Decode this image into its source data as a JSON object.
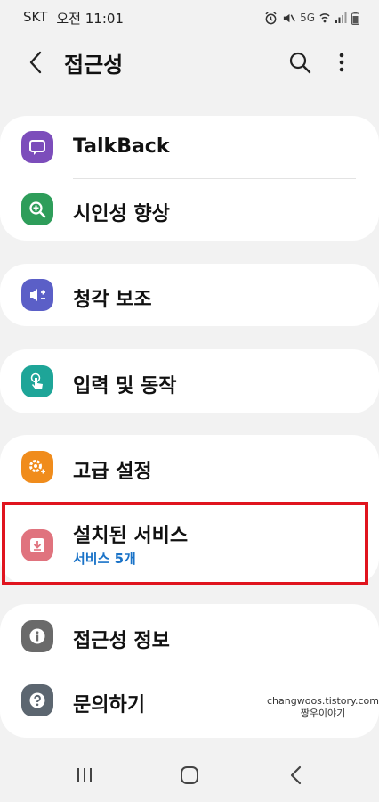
{
  "status_bar": {
    "carrier": "SKT",
    "time": "오전 11:01",
    "icons": [
      "alarm-icon",
      "mute-icon",
      "wifi-icon",
      "signal-icon",
      "battery-icon"
    ],
    "network_label": "5G"
  },
  "header": {
    "title": "접근성",
    "icons": [
      "back-icon",
      "search-icon",
      "more-vert-icon"
    ]
  },
  "groups": [
    {
      "items": [
        {
          "label": "TalkBack",
          "icon": "talkback-icon",
          "color": "#7c4dbb"
        },
        {
          "label": "시인성 향상",
          "icon": "magnify-plus-icon",
          "color": "#2e9d5a"
        }
      ]
    },
    {
      "items": [
        {
          "label": "청각 보조",
          "icon": "hearing-volume-icon",
          "color": "#5b5fc7"
        }
      ]
    },
    {
      "items": [
        {
          "label": "입력 및 동작",
          "icon": "touch-hand-icon",
          "color": "#1ea598"
        }
      ]
    },
    {
      "items": [
        {
          "label": "고급 설정",
          "icon": "gear-plus-icon",
          "color": "#f08c1c"
        },
        {
          "label": "설치된 서비스",
          "sublabel": "서비스 5개",
          "icon": "download-icon",
          "color": "#e0737e"
        }
      ]
    },
    {
      "items": [
        {
          "label": "접근성 정보",
          "icon": "info-icon",
          "color": "#6a6a6a"
        },
        {
          "label": "문의하기",
          "icon": "help-icon",
          "color": "#5c6670"
        }
      ]
    }
  ],
  "highlight_color": "#e0141e",
  "watermark": {
    "line1": "changwoos.tistory.com",
    "line2": "짱우이야기"
  },
  "nav_bar": {
    "icons": [
      "recent-apps-icon",
      "home-icon",
      "back-nav-icon"
    ]
  }
}
